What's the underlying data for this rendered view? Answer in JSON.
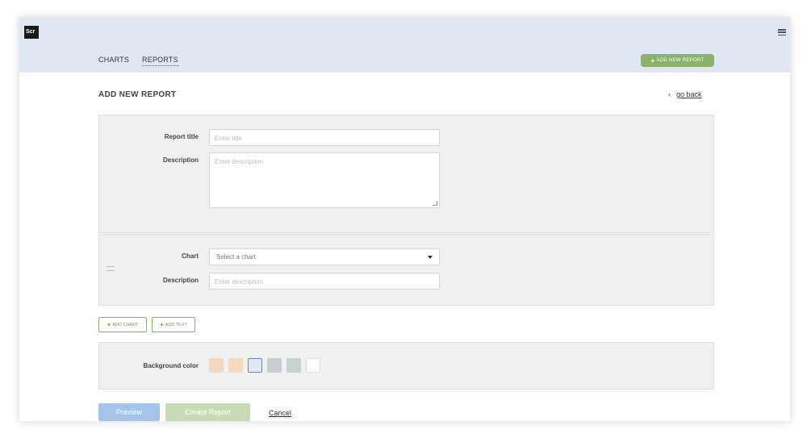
{
  "header": {
    "logo_text": "Scr",
    "nav": [
      {
        "label": "CHARTS"
      },
      {
        "label": "REPORTS"
      }
    ],
    "add_button": {
      "plus": "+",
      "label": "ADD NEW REPORT"
    },
    "accent_color": "#8ab36a",
    "background_color": "#e0e7f2"
  },
  "page": {
    "title": "ADD NEW REPORT",
    "go_back": {
      "arrow": "‹",
      "label": "go back"
    }
  },
  "report_panel": {
    "title_label": "Report title",
    "title_placeholder": "Enter title",
    "description_label": "Description",
    "description_placeholder": "Enter description"
  },
  "chart_panel": {
    "chart_label": "Chart",
    "chart_select_value": "Select a chart",
    "description_label": "Description",
    "description_placeholder": "Enter description"
  },
  "buttons": {
    "add_chart": {
      "plus": "+",
      "label": "ADD CHART"
    },
    "add_text": {
      "plus": "+",
      "label": "ADD TEXT"
    }
  },
  "background_panel": {
    "label": "Background color",
    "swatches": [
      {
        "color": "#f3d9c4",
        "selected": false
      },
      {
        "color": "#f5d9c1",
        "selected": false
      },
      {
        "color": "#e1e8f5",
        "selected": true
      },
      {
        "color": "#c6cecf",
        "selected": false
      },
      {
        "color": "#c4d3d2",
        "selected": false
      },
      {
        "color": "#ffffff",
        "selected": false
      }
    ]
  },
  "footer": {
    "preview_label": "Preview",
    "create_label": "Create Report",
    "cancel_label": "Cancel"
  }
}
